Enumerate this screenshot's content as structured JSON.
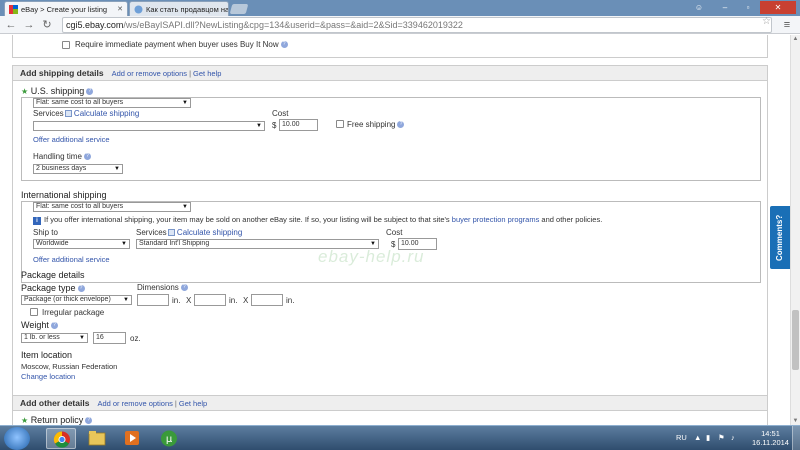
{
  "browser": {
    "tabs": [
      {
        "title": "eBay > Create your listing",
        "active": true
      },
      {
        "title": "Как стать продавцом на e",
        "active": false
      }
    ],
    "address_host": "cgi5.ebay.com",
    "address_path": "/ws/eBayISAPI.dll?NewListing&cpg=134&userid=&pass=&aid=2&Sid=339462019322"
  },
  "top": {
    "require_payment_label": "Require immediate payment when buyer uses Buy It Now"
  },
  "shipping": {
    "title": "Add shipping details",
    "link_add_remove": "Add or remove options",
    "separator": "|",
    "link_help": "Get help",
    "us": {
      "label": "U.S. shipping",
      "method": "Flat: same cost to all buyers",
      "services_label": "Services",
      "calc_link": "Calculate shipping",
      "service_value": "",
      "cost_label": "Cost",
      "currency": "$",
      "cost_value": "10.00",
      "free_shipping": "Free shipping",
      "offer_additional": "Offer additional service",
      "handling_label": "Handling time",
      "handling_value": "2 business days"
    },
    "intl": {
      "label": "International shipping",
      "method": "Flat: same cost to all buyers",
      "notice": "If you offer international shipping, your item may be sold on another eBay site. If so, your listing will be subject to that site's",
      "notice_link": "buyer protection programs",
      "notice_tail": "and other policies.",
      "ship_to_label": "Ship to",
      "ship_to_value": "Worldwide",
      "services_label": "Services",
      "calc_link": "Calculate shipping",
      "service_value": "Standard Int'l Shipping",
      "cost_label": "Cost",
      "currency": "$",
      "cost_value": "10.00",
      "offer_additional": "Offer additional service"
    },
    "package": {
      "title": "Package details",
      "type_label": "Package type",
      "type_value": "Package (or thick envelope)",
      "dimensions_label": "Dimensions",
      "unit_in": "in.",
      "x": "X",
      "irregular": "Irregular package",
      "weight_label": "Weight",
      "weight_value": "1 lb. or less",
      "oz_value": "16",
      "oz_unit": "oz."
    },
    "location": {
      "title": "Item location",
      "value": "Moscow, Russian Federation",
      "change_link": "Change location"
    }
  },
  "other": {
    "title": "Add other details",
    "link_add_remove": "Add or remove options",
    "separator": "|",
    "link_help": "Get help",
    "return_policy": "Return policy"
  },
  "comments_tab": "Comments?",
  "watermark": "ebay-help.ru",
  "taskbar": {
    "lang": "RU",
    "time": "14:51",
    "date": "16.11.2014"
  },
  "colors": {
    "link": "#3355aa",
    "comments_tab": "#1a6fb6",
    "section_header_bg": "#eeeeee"
  }
}
